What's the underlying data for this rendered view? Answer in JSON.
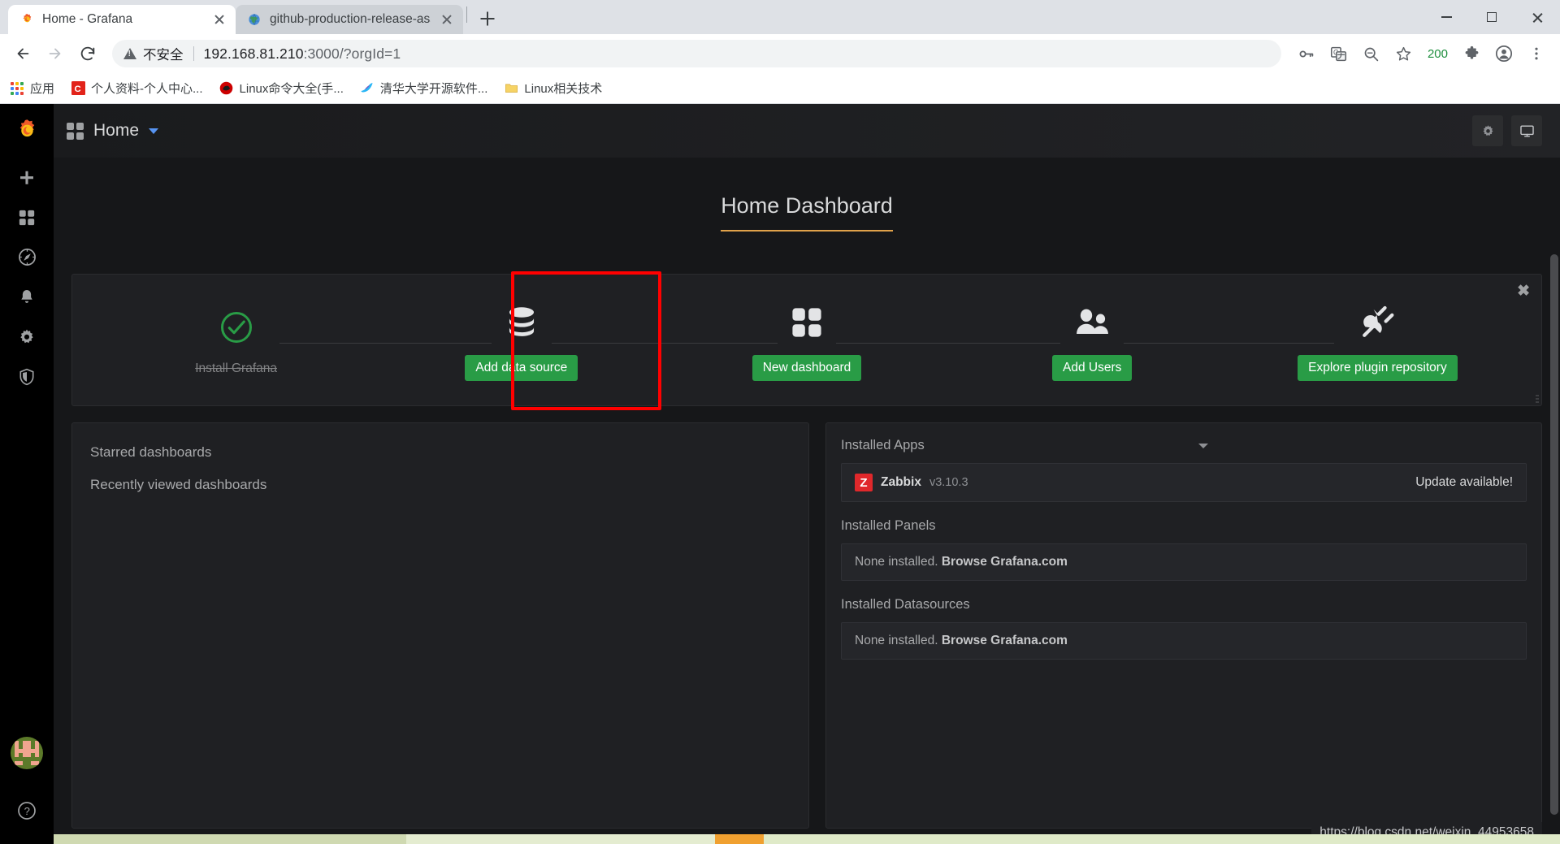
{
  "browser": {
    "tabs": [
      {
        "title": "Home - Grafana",
        "favicon": "grafana-icon",
        "active": true
      },
      {
        "title": "github-production-release-ass",
        "favicon": "globe-icon",
        "active": false
      }
    ],
    "newtab_label": "+",
    "window_controls": {
      "minimize": "minimize-icon",
      "maximize": "maximize-icon",
      "close": "close-icon"
    },
    "nav": {
      "back": "back-arrow-icon",
      "forward": "forward-arrow-icon",
      "reload": "reload-icon"
    },
    "omnibox": {
      "security_label": "不安全",
      "url_host": "192.168.81.210",
      "url_rest": ":3000/?orgId=1"
    },
    "toolbar_icons": [
      "key-icon",
      "translate-icon",
      "zoom-out-icon",
      "star-icon"
    ],
    "zoom_level": "200",
    "right_icons": [
      "extensions-puzzle-icon",
      "profile-avatar-icon",
      "three-dot-menu-icon"
    ],
    "bookmarks": [
      {
        "label": "应用",
        "icon": "apps-grid-icon"
      },
      {
        "label": "个人资料-个人中心...",
        "icon": "csdn-icon"
      },
      {
        "label": "Linux命令大全(手...",
        "icon": "redhat-icon"
      },
      {
        "label": "清华大学开源软件...",
        "icon": "tuna-bird-icon"
      },
      {
        "label": "Linux相关技术",
        "icon": "folder-icon"
      }
    ]
  },
  "grafana": {
    "sidebar": {
      "logo": "grafana-logo-icon",
      "items": [
        {
          "name": "create-add",
          "icon": "plus-icon"
        },
        {
          "name": "dashboards",
          "icon": "dashboards-grid-icon"
        },
        {
          "name": "explore",
          "icon": "compass-icon"
        },
        {
          "name": "alerting",
          "icon": "bell-icon"
        },
        {
          "name": "configuration",
          "icon": "gear-icon"
        },
        {
          "name": "server-admin",
          "icon": "shield-icon"
        }
      ],
      "avatar": "user-avatar-icon",
      "help": "help-question-icon"
    },
    "topnav": {
      "breadcrumb_icon": "dashboards-grid-icon",
      "title": "Home",
      "caret": "chevron-down-icon",
      "settings_icon": "gear-icon",
      "tv_icon": "tv-monitor-icon"
    },
    "dashboard_title": "Home Dashboard",
    "getting_started": {
      "close_label": "✖",
      "steps": [
        {
          "icon": "check-circle-icon",
          "label": "Install Grafana",
          "done": true
        },
        {
          "icon": "database-icon",
          "button": "Add data source",
          "highlighted": true
        },
        {
          "icon": "dashboards-grid-icon",
          "button": "New dashboard"
        },
        {
          "icon": "users-icon",
          "button": "Add Users"
        },
        {
          "icon": "plugin-plug-icon",
          "button": "Explore plugin repository"
        }
      ]
    },
    "left_panel": {
      "rows": [
        "Starred dashboards",
        "Recently viewed dashboards"
      ]
    },
    "right_panel": {
      "sections": [
        {
          "heading": "Installed Apps",
          "has_caret": true,
          "items": [
            {
              "logo_letter": "Z",
              "name": "Zabbix",
              "version": "v3.10.3",
              "status": "Update available!"
            }
          ]
        },
        {
          "heading": "Installed Panels",
          "has_caret": false,
          "empty_text": "None installed. ",
          "empty_link": "Browse Grafana.com"
        },
        {
          "heading": "Installed Datasources",
          "has_caret": false,
          "empty_text": "None installed. ",
          "empty_link": "Browse Grafana.com"
        }
      ]
    },
    "statusbar_url": "https://blog.csdn.net/weixin_44953658"
  },
  "colors": {
    "accent_orange": "#e0a24a",
    "green_button": "#299c46",
    "highlight_red": "#ff0000",
    "zabbix_red": "#e0282b",
    "zoom_green": "#1e8e3e"
  }
}
